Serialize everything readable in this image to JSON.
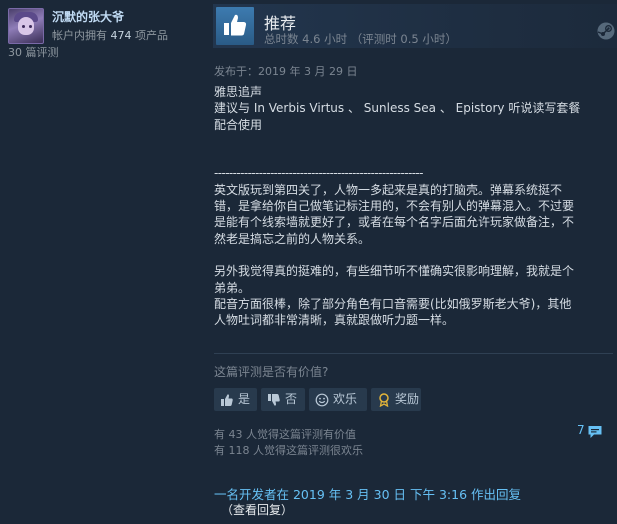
{
  "reviewer": {
    "name": "沉默的张大爷",
    "products_owned_prefix": "帐户内拥有",
    "products_owned_count": "474",
    "products_owned_suffix": "项产品",
    "review_count": "30 篇评测"
  },
  "review": {
    "recommendation": "推荐",
    "hours_on_record": "总时数 4.6 小时 （评测时 0.5 小时）",
    "posted_date": "发布于：2019 年 3 月 29 日",
    "body": [
      "雅思追声",
      "建议与 In Verbis Virtus 、 Sunless Sea 、 Epistory 听说读写套餐",
      "配合使用",
      "--------------------------------------------------------",
      "英文版玩到第四关了，人物一多起来是真的打脑壳。弹幕系统挺不",
      "错，是拿给你自己做笔记标注用的，不会有别人的弹幕混入。不过要",
      "是能有个线索墙就更好了，或者在每个名字后面允许玩家做备注，不",
      "然老是搞忘之前的人物关系。",
      "另外我觉得真的挺难的，有些细节听不懂确实很影响理解，我就是个",
      "弟弟。",
      "配音方面很棒，除了部分角色有口音需要(比如俄罗斯老大爷)，其他",
      "人物吐词都非常清晰，真就跟做听力题一样。"
    ]
  },
  "feedback": {
    "question": "这篇评测是否有价值?",
    "yes_label": "是",
    "no_label": "否",
    "funny_label": "欢乐",
    "award_label": "奖励",
    "helpful_stat": "有 43 人觉得这篇评测有价值",
    "funny_stat": "有 118 人觉得这篇评测很欢乐",
    "comment_count": "7"
  },
  "developer_response": {
    "text": "一名开发者在 2019 年 3 月 30 日 下午 3:16 作出回复",
    "view_label": "（查看回复）"
  },
  "colors": {
    "background": "#1b2838",
    "link": "#66c0f4",
    "recommend_icon": "#3d7bb0"
  },
  "icons": [
    "thumbs-up-icon",
    "steam-logo-icon",
    "thumbs-down-icon",
    "smiley-icon",
    "award-icon",
    "comment-icon"
  ]
}
